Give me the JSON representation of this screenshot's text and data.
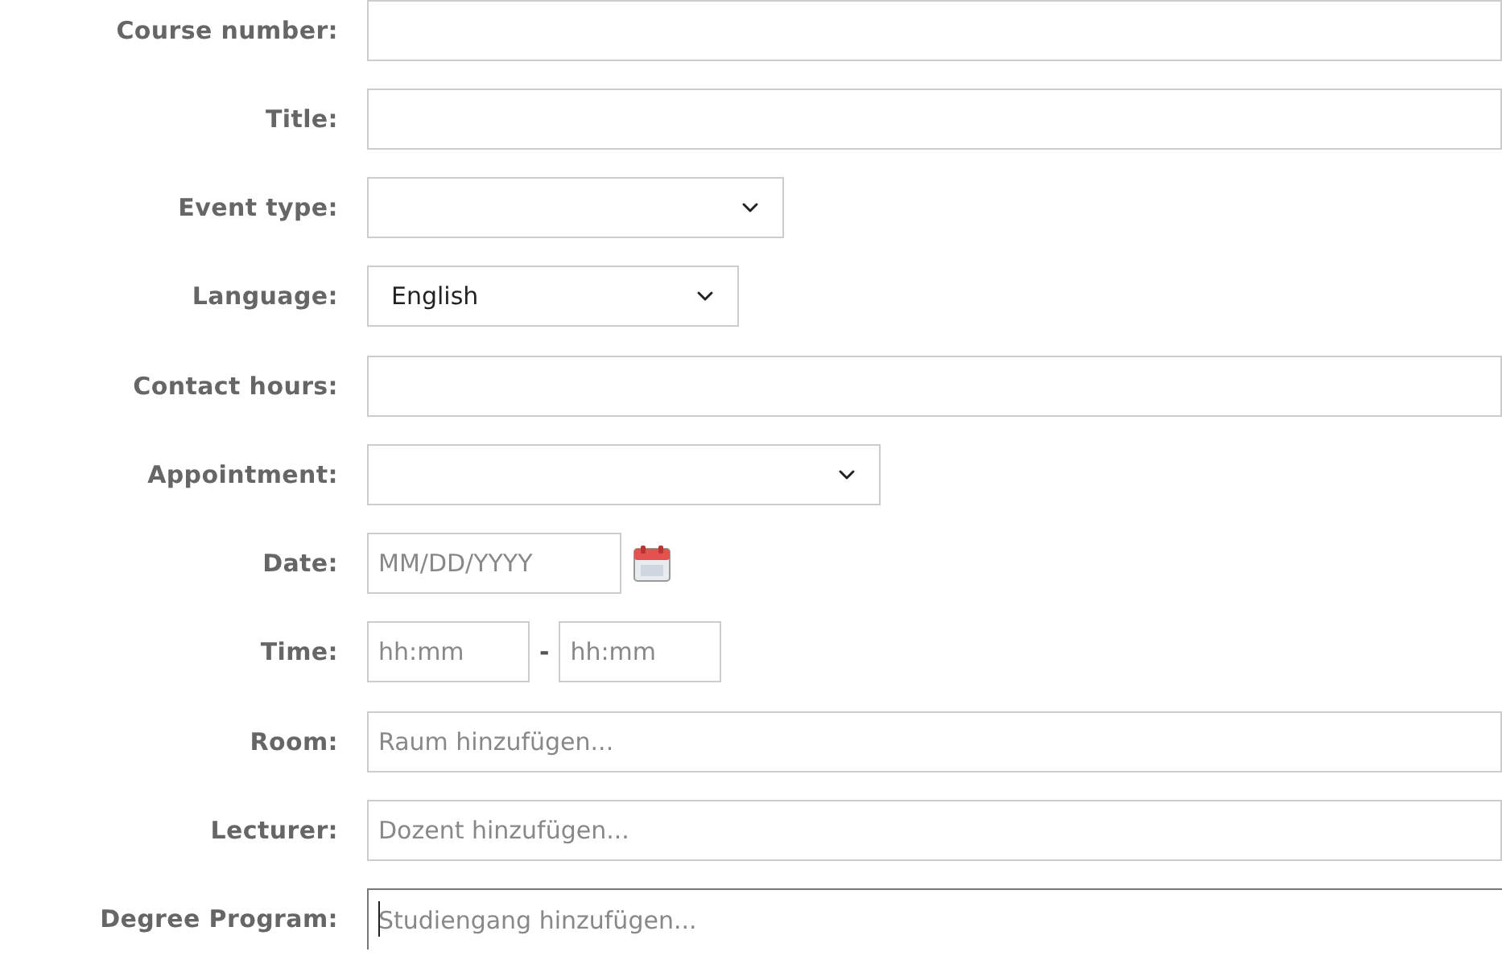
{
  "fields": [
    {
      "label": "Course number:",
      "kind": "text",
      "focused": false
    },
    {
      "label": "Title:",
      "kind": "text",
      "focused": false
    },
    {
      "label": "Event type:",
      "kind": "select"
    },
    {
      "label": "Language:",
      "kind": "select",
      "value": "English"
    },
    {
      "label": "Contact hours:",
      "kind": "text",
      "focused": false
    },
    {
      "label": "Appointment:",
      "kind": "select"
    },
    {
      "label": "Date:",
      "kind": "date",
      "placeholder": "MM/DD/YYYY"
    },
    {
      "label": "Time:",
      "kind": "time",
      "placeholder": "hh:mm",
      "separator": "-",
      "placeholder_end": "hh:mm"
    },
    {
      "label": "Room:",
      "kind": "text",
      "placeholder": "Raum hinzufügen...",
      "focused": false
    },
    {
      "label": "Lecturer:",
      "kind": "text",
      "placeholder": "Dozent hinzufügen...",
      "focused": false
    },
    {
      "label": "Degree Program:",
      "kind": "text",
      "placeholder": "Studiengang hinzufügen...",
      "focused": true
    }
  ]
}
